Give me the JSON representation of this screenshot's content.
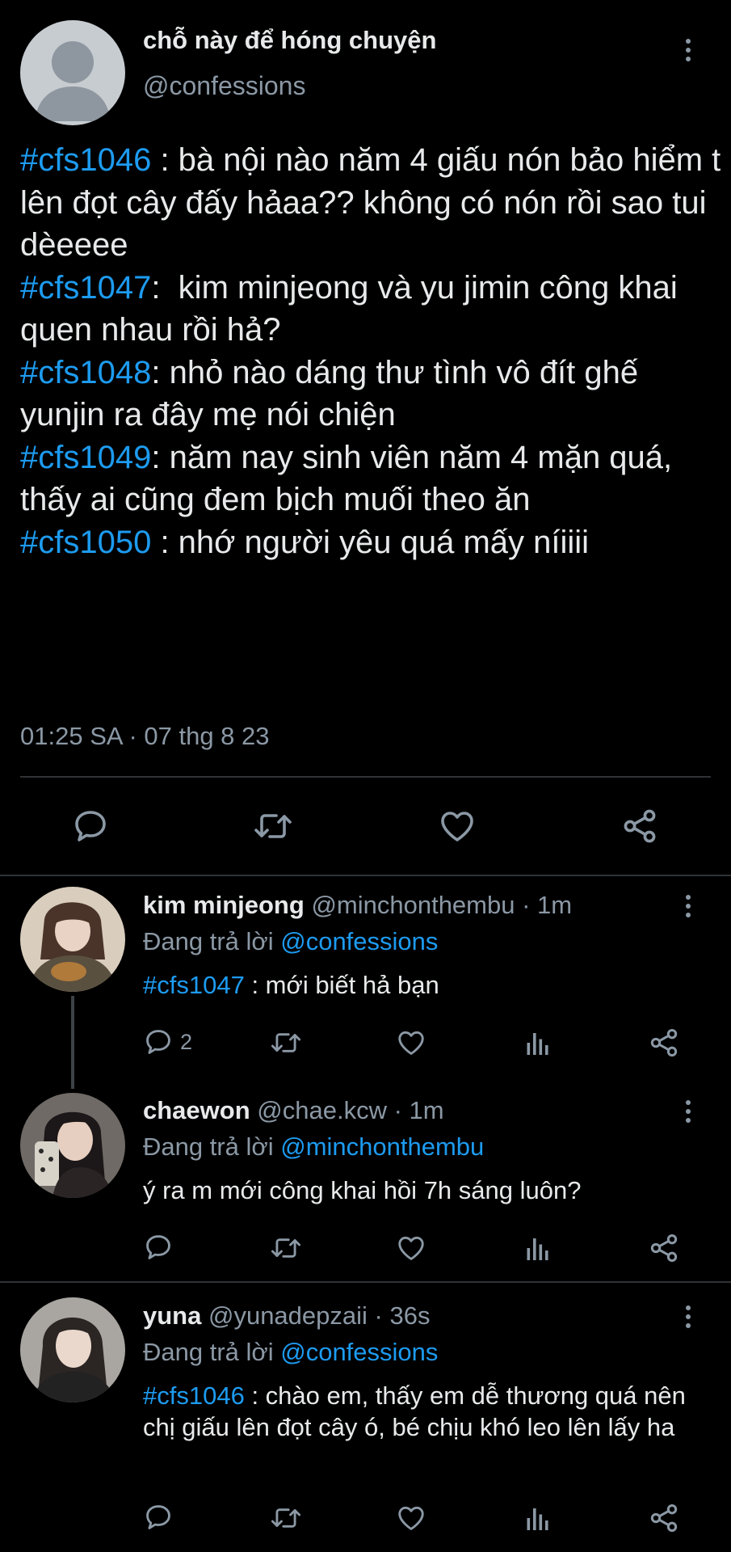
{
  "main_tweet": {
    "display_name": "chỗ này để hóng chuyện",
    "handle": "@confessions",
    "lines": [
      {
        "tag": "#cfs1046",
        "text": " : bà nội nào năm 4 giấu nón bảo hiểm t lên đọt cây đấy hảaa?? không có nón rồi sao tui dèeeee"
      },
      {
        "tag": "#cfs1047",
        "text": ":  kim minjeong và yu jimin công khai quen nhau rồi hả?"
      },
      {
        "tag": "#cfs1048",
        "text": ": nhỏ nào dáng thư tình vô đít ghế yunjin ra đây mẹ nói chiện"
      },
      {
        "tag": "#cfs1049",
        "text": ": năm nay sinh viên năm 4 mặn quá, thấy ai cũng đem bịch muối theo ăn"
      },
      {
        "tag": "#cfs1050",
        "text": " : nhớ người yêu quá mấy níiiii"
      }
    ],
    "timestamp": "01:25 SA · 07 thg 8 23",
    "actions": [
      "reply-icon",
      "retweet-icon",
      "like-icon",
      "share-icon"
    ]
  },
  "replies": [
    {
      "display_name": "kim minjeong",
      "handle": "@minchonthembu",
      "time": "· 1m",
      "replying_label": "Đang trả lời ",
      "replying_to": "@confessions",
      "tag": "#cfs1047",
      "text": " : mới biết hả bạn",
      "reply_count": "2",
      "avatar_colors": [
        "#c9b9a6",
        "#3b2a22"
      ]
    },
    {
      "display_name": "chaewon",
      "handle": "@chae.kcw",
      "time": "· 1m",
      "replying_label": "Đang trả lời ",
      "replying_to": "@minchonthembu",
      "tag": "",
      "text": "ý ra m mới công khai hồi 7h sáng luôn?",
      "reply_count": "",
      "avatar_colors": [
        "#7a6f6a",
        "#1a1616"
      ]
    },
    {
      "display_name": "yuna",
      "handle": "@yunadepzaii",
      "time": "· 36s",
      "replying_label": "Đang trả lời ",
      "replying_to": "@confessions",
      "tag": "#cfs1046",
      "text": " : chào em, thấy em dễ thương quá nên chị giấu lên đọt cây ó, bé chịu khó leo lên lấy ha",
      "reply_count": "",
      "avatar_colors": [
        "#a7a29e",
        "#2a2624"
      ]
    }
  ],
  "colors": {
    "background": "#000000",
    "text": "#e7e9ea",
    "muted": "#8b98a5",
    "accent": "#1d9bf0",
    "divider": "#2f3336"
  }
}
